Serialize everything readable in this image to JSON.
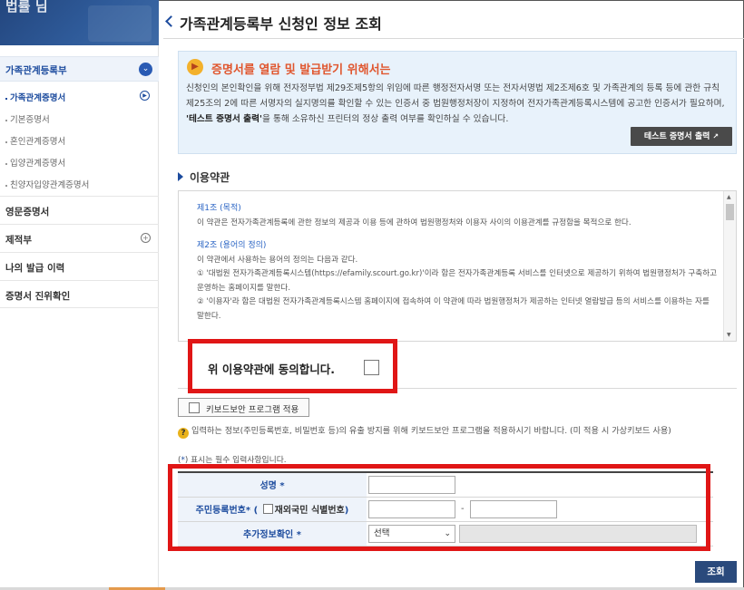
{
  "sidebar": {
    "banner_glyph": "법률 님",
    "header": "가족관계등록부",
    "sub_items": [
      {
        "label": "가족관계증명서",
        "active": true
      },
      {
        "label": "기본증명서",
        "active": false
      },
      {
        "label": "혼인관계증명서",
        "active": false
      },
      {
        "label": "입양관계증명서",
        "active": false
      },
      {
        "label": "친양자입양관계증명서",
        "active": false
      }
    ],
    "items": [
      {
        "label": "영문증명서"
      },
      {
        "label": "제적부"
      },
      {
        "label": "나의 발급 이력"
      },
      {
        "label": "증명서 진위확인"
      }
    ]
  },
  "page": {
    "title": "가족관계등록부 신청인 정보 조회"
  },
  "notice": {
    "icon": "megaphone-icon",
    "heading": "증명서를 열람 및 발급받기 위해서는",
    "body_part1": "신청인의 본인확인을 위해 전자정부법 제29조제5항의 위임에 따른 행정전자서명 또는 전자서명법 제2조제6호 및 가족관계의 등록 등에 관한 규칙 제25조의 2에 따른 서명자의 실지명의를 확인할 수 있는 인증서 중 법원행정처장이 지정하여 전자가족관계등록시스템에 공고한 인증서가 필요하며, ",
    "body_bold": "'테스트 증명서 출력'",
    "body_part2": "을 통해 소유하신 프린터의 정상 출력 여부를 확인하실 수 있습니다.",
    "test_button": "테스트 증명서 출력"
  },
  "terms": {
    "section_title": "이용약관",
    "articles": [
      {
        "title": "제1조 (목적)",
        "lines": [
          "이 약관은 전자가족관계등록에 관한 정보의 제공과 이용 등에 관하여 법원행정처와 이용자 사이의 이용관계를 규정함을 목적으로 한다."
        ]
      },
      {
        "title": "제2조 (용어의 정의)",
        "lines": [
          "이 약관에서 사용하는 용어의 정의는 다음과 같다.",
          "① '대법원 전자가족관계등록시스템(https://efamily.scourt.go.kr)'이라 함은 전자가족관계등록 서비스를 인터넷으로 제공하기 위하여 법원행정처가 구축하고 운영하는 홈페이지를 말한다.",
          "② '이용자'라 함은 대법원 전자가족관계등록시스템 홈페이지에 접속하여 이 약관에 따라 법원행정처가 제공하는 인터넷 열람발급 등의 서비스를 이용하는 자를 말한다."
        ]
      }
    ],
    "agree_label": "위 이용약관에 동의합니다."
  },
  "keyboard": {
    "button_label": "키보드보안 프로그램 적용",
    "note": "입력하는 정보(주민등록번호, 비밀번호 등)의 유출 방지를 위해 키보드보안 프로그램을 적용하시기 바랍니다. (미 적용 시 가상키보드 사용)"
  },
  "form": {
    "required_note_prefix": "(",
    "required_note_star": "*",
    "required_note_rest": ") 표시는 필수 입력사항입니다.",
    "rows": [
      {
        "label": "성명",
        "star": "*"
      },
      {
        "label": "주민등록번호",
        "star": "*",
        "extra": "재외국민 식별번호"
      },
      {
        "label": "추가정보확인",
        "star": "*"
      }
    ],
    "select_value": "선택",
    "search_button": "조회"
  },
  "colors": {
    "accent": "#1d4c9e",
    "highlight": "#e01616",
    "notice_heading": "#e0562e"
  }
}
